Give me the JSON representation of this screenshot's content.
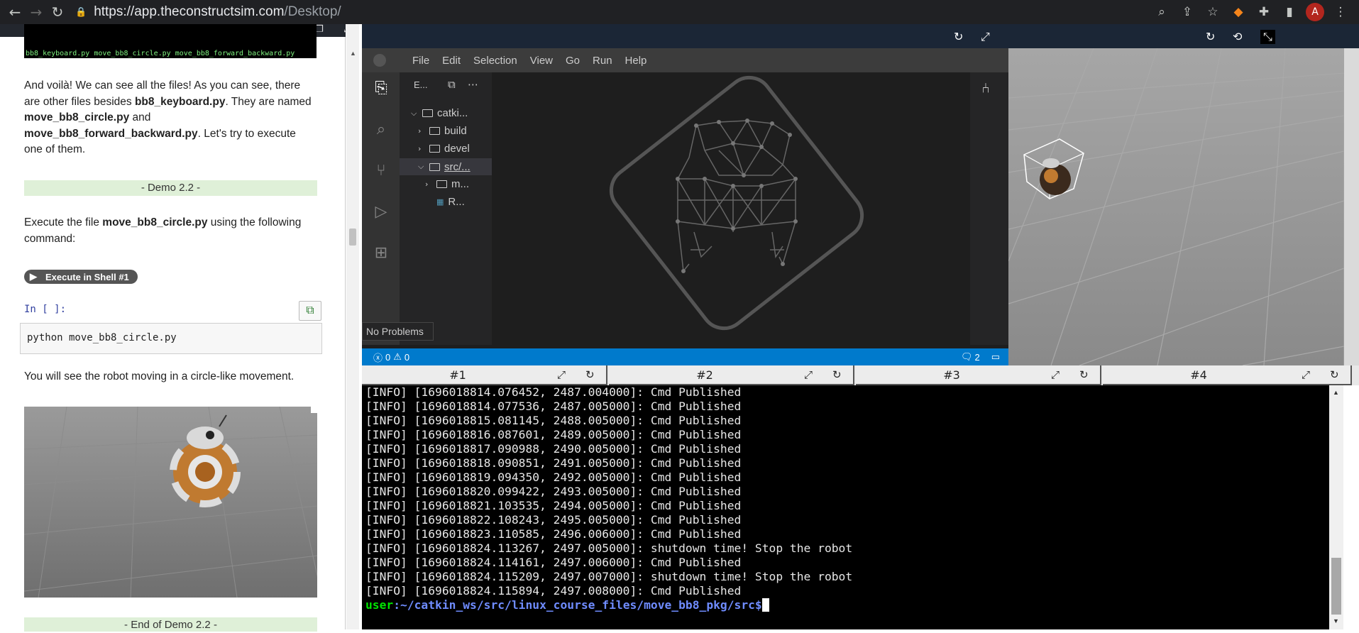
{
  "browser": {
    "url_host": "https://app.theconstructsim.com",
    "url_path": "/Desktop/",
    "avatar_letter": "A"
  },
  "notebook": {
    "terminal_strip_text": "bb8_keyboard.py  move_bb8_circle.py  move_bb8_forward_backward.py",
    "para1": {
      "t1": "And voilà! We can see all the files! As you can see, there are other files besides ",
      "b1": "bb8_keyboard.py",
      "t2": ". They are named ",
      "b2": "move_bb8_circle.py",
      "t3": " and ",
      "b3": "move_bb8_forward_backward.py",
      "t4": ". Let's try to execute one of them."
    },
    "demo_title": "- Demo 2.2 -",
    "para2": {
      "t1": "Execute the file ",
      "b1": "move_bb8_circle.py",
      "t2": " using the following command:"
    },
    "exec_button": "Execute in Shell #1",
    "in_prompt": "In [ ]:",
    "code": "python move_bb8_circle.py",
    "para3": "You will see the robot moving in a circle-like movement.",
    "demo_end": "- End of Demo 2.2 -"
  },
  "vscode": {
    "menu": [
      "File",
      "Edit",
      "Selection",
      "View",
      "Go",
      "Run",
      "Help"
    ],
    "explorer_header": "E...",
    "tree": [
      {
        "label": "catki...",
        "kind": "folder",
        "open": true
      },
      {
        "label": "build",
        "kind": "folder",
        "open": false
      },
      {
        "label": "devel",
        "kind": "folder",
        "open": false
      },
      {
        "label": "src/...",
        "kind": "folder",
        "open": true
      },
      {
        "label": "m...",
        "kind": "folder",
        "open": false
      },
      {
        "label": "R...",
        "kind": "file"
      }
    ],
    "no_problems": "No Problems",
    "status": {
      "errors": "0",
      "warnings": "0",
      "notifications": "2"
    }
  },
  "terminal_tabs": [
    "#1",
    "#2",
    "#3",
    "#4"
  ],
  "terminal": {
    "lines": [
      "[INFO] [1696018814.076452, 2487.004000]: Cmd Published",
      "[INFO] [1696018814.077536, 2487.005000]: Cmd Published",
      "[INFO] [1696018815.081145, 2488.005000]: Cmd Published",
      "[INFO] [1696018816.087601, 2489.005000]: Cmd Published",
      "[INFO] [1696018817.090988, 2490.005000]: Cmd Published",
      "[INFO] [1696018818.090851, 2491.005000]: Cmd Published",
      "[INFO] [1696018819.094350, 2492.005000]: Cmd Published",
      "[INFO] [1696018820.099422, 2493.005000]: Cmd Published",
      "[INFO] [1696018821.103535, 2494.005000]: Cmd Published",
      "[INFO] [1696018822.108243, 2495.005000]: Cmd Published",
      "[INFO] [1696018823.110585, 2496.006000]: Cmd Published",
      "[INFO] [1696018824.113267, 2497.005000]: shutdown time! Stop the robot",
      "[INFO] [1696018824.114161, 2497.006000]: Cmd Published",
      "[INFO] [1696018824.115209, 2497.007000]: shutdown time! Stop the robot",
      "[INFO] [1696018824.115894, 2497.008000]: Cmd Published"
    ],
    "prompt_user": "user",
    "prompt_path": ":~/catkin_ws/src/linux_course_files/move_bb8_pkg/src$"
  }
}
